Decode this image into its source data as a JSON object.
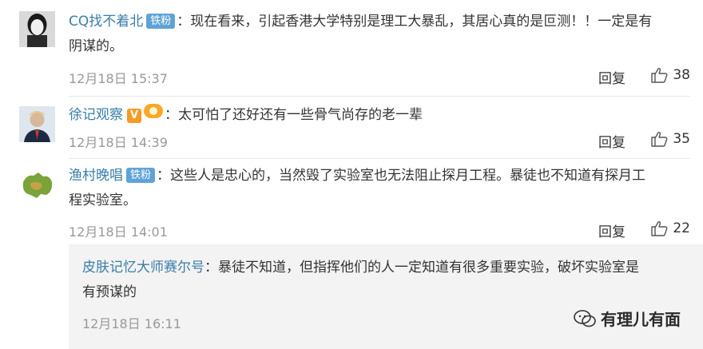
{
  "comments": [
    {
      "username": "CQ找不着北",
      "badge": "铁粉",
      "text_line1": "：现在看来，引起香港大学特别是理工大暴乱，其居心真的是叵测！！一定是有",
      "text_line2": "阴谋的。",
      "time": "12月18日 15:37",
      "reply_label": "回复",
      "likes": "38"
    },
    {
      "username": "徐记观察",
      "text_line1": "：太可怕了还好还有一些骨气尚存的老一辈",
      "time": "12月18日 14:39",
      "reply_label": "回复",
      "likes": "35",
      "vip_badge": "V"
    },
    {
      "username": "渔村晚唱",
      "badge": "铁粉",
      "text_line1": "：这些人是忠心的，当然毁了实验室也无法阻止探月工程。暴徒也不知道有探月工",
      "text_line2": "程实验室。",
      "time": "12月18日 14:01",
      "reply_label": "回复",
      "likes": "22"
    }
  ],
  "nested_reply": {
    "username": "皮肤记忆大师赛尔号",
    "text_line1": "：暴徒不知道，但指挥他们的人一定知道有很多重要实验，破坏实验室是",
    "text_line2": "有预谋的",
    "time": "12月18日 16:11"
  },
  "watermark": "有理儿有面",
  "colors": {
    "username": "#3a7ea8",
    "badge": "#5fa3d6",
    "meta": "#999999",
    "reply_bg": "#f3f3f3"
  }
}
